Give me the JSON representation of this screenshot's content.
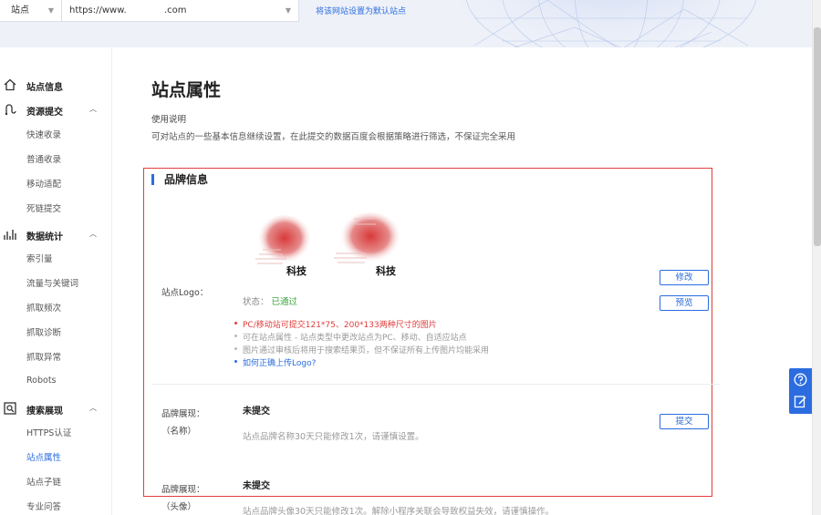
{
  "topbar": {
    "site_select": "站点",
    "url_value": "https://www.             .com",
    "set_default_link": "将该网站设置为默认站点"
  },
  "sidebar": {
    "groups": [
      {
        "label": "站点信息",
        "icon": "home-icon"
      },
      {
        "label": "资源提交",
        "icon": "resource-submit-icon",
        "items": [
          "快速收录",
          "普通收录",
          "移动适配",
          "死链提交"
        ]
      },
      {
        "label": "数据统计",
        "icon": "stats-chart-icon",
        "items": [
          "索引量",
          "流量与关键词",
          "抓取频次",
          "抓取诊断",
          "抓取异常",
          "Robots"
        ]
      },
      {
        "label": "搜索展现",
        "icon": "search-display-icon",
        "items": [
          "HTTPS认证",
          "站点属性",
          "站点子链",
          "专业问答"
        ]
      }
    ],
    "active_item": "站点属性"
  },
  "main": {
    "page_title": "站点属性",
    "usage_title": "使用说明",
    "usage_desc": "可对站点的一些基本信息继续设置，在此提交的数据百度会根据策略进行筛选，不保证完全采用",
    "brand_section_title": "品牌信息",
    "logo": {
      "label": "站点Logo：",
      "logo_text_1": "科技",
      "logo_text_2": "科技",
      "status_label": "状态：",
      "status_value": "已通过",
      "hints": [
        "PC/移动站可提交121*75、200*133两种尺寸的图片",
        "可在站点属性 - 站点类型中更改站点为PC、移动、自适应站点",
        "图片通过审核后将用于搜索结果页，但不保证所有上传图片均能采用",
        "如何正确上传Logo?"
      ],
      "edit_button": "修改",
      "preview_button": "预览"
    },
    "brand_name": {
      "label_line1": "品牌展现：",
      "label_line2": "（名称）",
      "value": "未提交",
      "note": "站点品牌名称30天只能修改1次，请谨慎设置。",
      "submit_button": "提交"
    },
    "brand_avatar": {
      "label_line1": "品牌展现：",
      "label_line2": "（头像）",
      "value": "未提交",
      "note": "站点品牌头像30天只能修改1次。解除小程序关联会导致权益失效，请谨慎操作。"
    }
  },
  "colors": {
    "accent": "#2b6de0",
    "highlight_border": "#e23c3c",
    "status_ok": "#3ca53c"
  },
  "float_tools": [
    "help-icon",
    "feedback-edit-icon"
  ]
}
